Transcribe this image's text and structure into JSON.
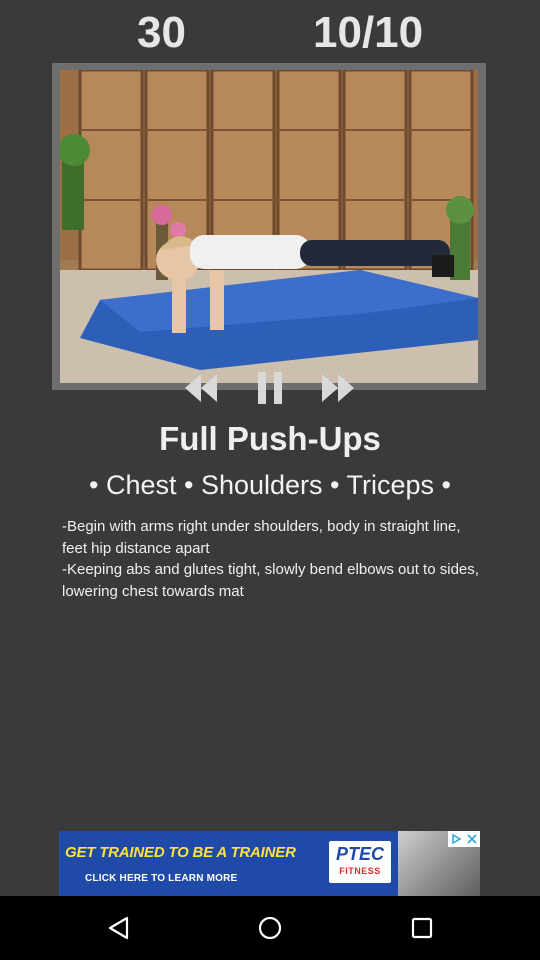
{
  "header": {
    "timer": "30",
    "progress": "10/10"
  },
  "video": {
    "icon": "exercise-video-thumbnail",
    "controls": {
      "rewind_icon": "rewind-icon",
      "pause_icon": "pause-icon",
      "forward_icon": "fast-forward-icon"
    }
  },
  "exercise": {
    "title": "Full Push-Ups",
    "muscles": "• Chest • Shoulders • Triceps •",
    "instructions": [
      "-Begin with arms right under shoulders, body in straight line, feet hip distance apart",
      "-Keeping abs and glutes tight, slowly bend elbows out to sides, lowering chest towards mat"
    ]
  },
  "ad": {
    "headline": "GET TRAINED TO BE A TRAINER",
    "cta": "CLICK HERE TO LEARN MORE",
    "brand": "PTEC",
    "brand_sub": "FITNESS",
    "colors": {
      "background": "#1f4aa8",
      "headline": "#ffe23a"
    }
  },
  "navbar": {
    "back_icon": "back-triangle-icon",
    "home_icon": "home-circle-icon",
    "recents_icon": "recents-square-icon"
  }
}
